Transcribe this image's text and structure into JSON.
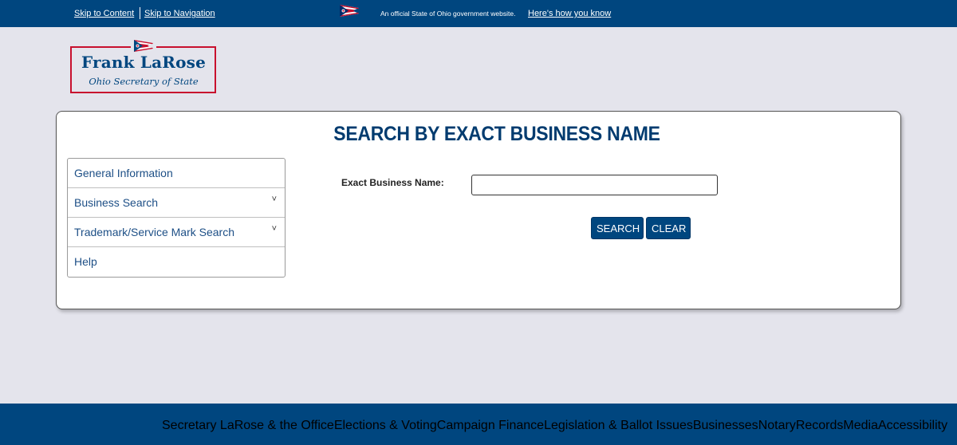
{
  "topbar": {
    "skip_content": "Skip to Content",
    "skip_navigation": "Skip to Navigation",
    "official_text": "An official State of Ohio government website.",
    "how_know": "Here's how you know"
  },
  "logo": {
    "name": "Frank LaRose",
    "subtitle": "Ohio Secretary of State"
  },
  "main": {
    "title": "SEARCH BY EXACT BUSINESS NAME",
    "field_label": "Exact Business Name:",
    "field_value": "",
    "search_label": "SEARCH",
    "clear_label": "CLEAR"
  },
  "sidebar": {
    "items": [
      {
        "label": "General Information"
      },
      {
        "label": "Business Search"
      },
      {
        "label": "Trademark/Service Mark Search"
      },
      {
        "label": "Help"
      }
    ]
  },
  "footer": {
    "links": [
      "Secretary LaRose & the Office",
      "Elections & Voting",
      "Campaign Finance",
      "Legislation & Ballot Issues",
      "Businesses",
      "Notary",
      "Records",
      "Media",
      "Accessibility"
    ]
  },
  "colors": {
    "brand_blue": "#00467f",
    "title_blue": "#003b6f",
    "logo_red": "#c8102e",
    "page_bg": "#e4e4ec"
  }
}
